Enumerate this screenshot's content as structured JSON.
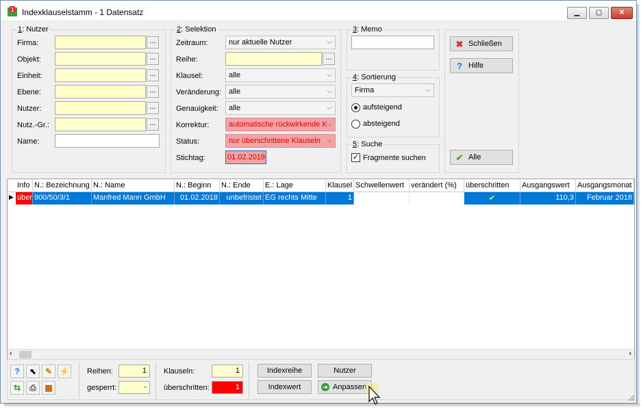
{
  "window": {
    "title": "Indexklauselstamm - 1 Datensatz"
  },
  "colors": {
    "yellow_field": "#ffffcc",
    "red_field": "#f2a3a3",
    "selection": "#0078d7",
    "alert": "#ff0000"
  },
  "nutzer": {
    "group_num": "1",
    "group_title": ": Nutzer",
    "fields": [
      {
        "label": "Firma:",
        "value": ""
      },
      {
        "label": "Objekt:",
        "value": ""
      },
      {
        "label": "Einheit:",
        "value": ""
      },
      {
        "label": "Ebene:",
        "value": ""
      },
      {
        "label": "Nutzer:",
        "value": ""
      },
      {
        "label": "Nutz.-Gr.:",
        "value": ""
      },
      {
        "label": "Name:",
        "value": ""
      }
    ],
    "dots": "..."
  },
  "selektion": {
    "group_num": "2",
    "group_title": ": Selektion",
    "zeitraum": {
      "label": "Zeitraum:",
      "value": "nur aktuelle Nutzer"
    },
    "reihe": {
      "label": "Reihe:",
      "value": ""
    },
    "klausel": {
      "label": "Klausel:",
      "value": "alle"
    },
    "veraenderung": {
      "label": "Veränderung:",
      "value": "alle"
    },
    "genauigkeit": {
      "label": "Genauigkeit:",
      "value": "alle"
    },
    "korrektur": {
      "label": "Korrektur:",
      "value": "automatische rückwirkende K"
    },
    "status": {
      "label": "Status:",
      "value": "nur überschrittene Klauseln"
    },
    "stichtag": {
      "label": "Stichtag:",
      "value": "01.02.2019"
    }
  },
  "memo": {
    "group_num": "3",
    "group_title": ": Memo",
    "value": ""
  },
  "sortierung": {
    "group_num": "4",
    "group_title": ": Sortierung",
    "field": "Firma",
    "asc_label": "aufsteigend",
    "desc_label": "absteigend"
  },
  "suche": {
    "group_num": "5",
    "group_title": ": Suche",
    "fragment_label": "Fragmente suchen"
  },
  "buttons": {
    "close": "Schließen",
    "help": "Hilfe",
    "all": "Alle"
  },
  "table": {
    "columns": [
      "Info",
      "N.: Bezeichnung",
      "N.: Name",
      "N.: Beginn",
      "N.: Ende",
      "E.: Lage",
      "Klausel",
      "Schwellenwert",
      "verändert (%)",
      "überschritten",
      "Ausgangswert",
      "Ausgangsmonat"
    ],
    "rows": [
      {
        "info": "über",
        "bezeichnung": "900/50/3/1",
        "name": "Manfred Mann GmbH",
        "beginn": "01.02.2018",
        "ende": "unbefristet",
        "lage": "EG rechts Mitte",
        "klausel": "1",
        "schwellenwert": "",
        "veraendert": "",
        "ueberschritten": "✔",
        "ausgangswert": "110,3",
        "ausgangsmonat": "Februar 2018"
      }
    ]
  },
  "footer": {
    "reihen_label": "Reihen:",
    "reihen_value": "1",
    "gesperrt_label": "gesperrt:",
    "gesperrt_value": "-",
    "klauseln_label": "Klauseln:",
    "klauseln_value": "1",
    "ueberschritten_label": "überschritten:",
    "ueberschritten_value": "1",
    "btn_indexreihe": "Indexreihe",
    "btn_nutzer": "Nutzer",
    "btn_indexwert": "Indexwert",
    "btn_anpassen": "Anpassen"
  }
}
